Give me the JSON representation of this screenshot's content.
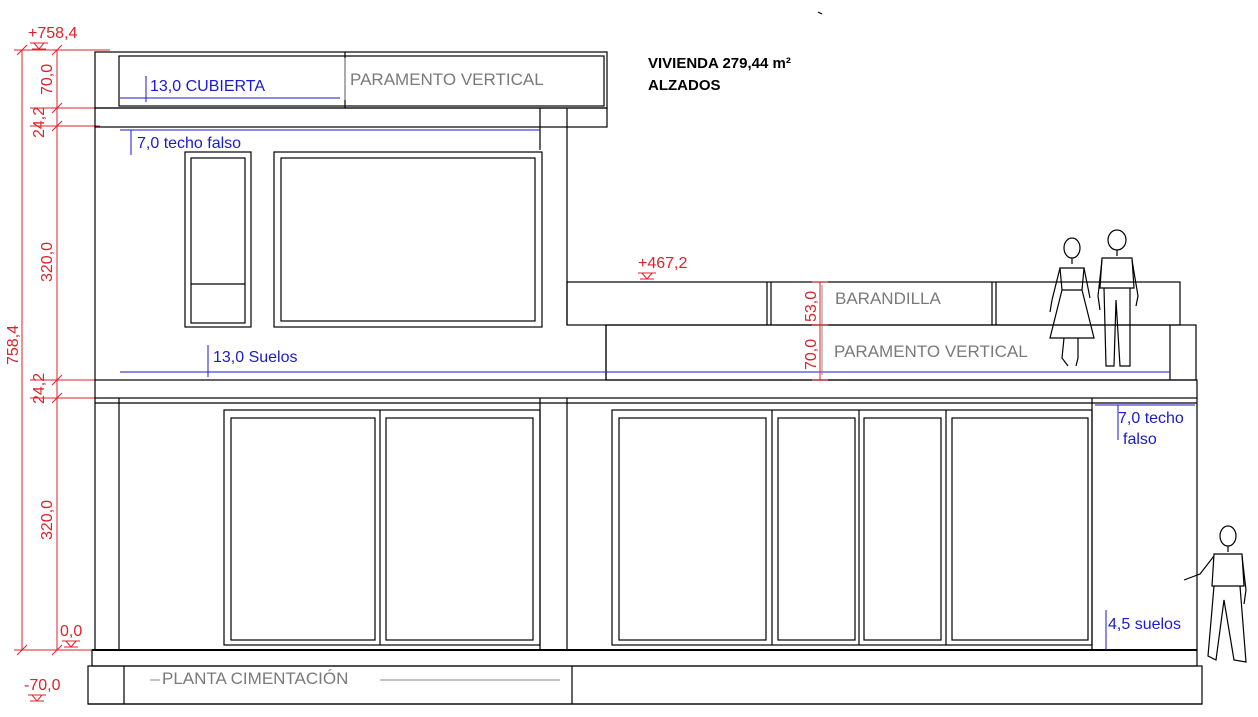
{
  "title": {
    "line1": "VIVIENDA 279,44 m²",
    "line2": "ALZADOS"
  },
  "levels": {
    "top": "+758,4",
    "terrace": "+467,2",
    "ground": "0,0",
    "foundation": "-70,0"
  },
  "dimensions": {
    "total": "758,4",
    "roof_parapet": "70,0",
    "upper_slab": "24,2",
    "upper_floor": "320,0",
    "mid_slab": "24,2",
    "lower_floor": "320,0",
    "railing_height": "53,0",
    "parapet_height": "70,0"
  },
  "labels": {
    "cubierta": "13,0 CUBIERTA",
    "parapet_top": "PARAMENTO VERTICAL",
    "techo_falso_upper": "7,0 techo falso",
    "suelos_upper": "13,0 Suelos",
    "barandilla": "BARANDILLA",
    "parapet_terrace": "PARAMENTO VERTICAL",
    "techo_falso_lower_1": "7,0 techo",
    "techo_falso_lower_2": "falso",
    "suelos_lower": "4,5 suelos",
    "cimentacion": "PLANTA CIMENTACIÓN"
  }
}
